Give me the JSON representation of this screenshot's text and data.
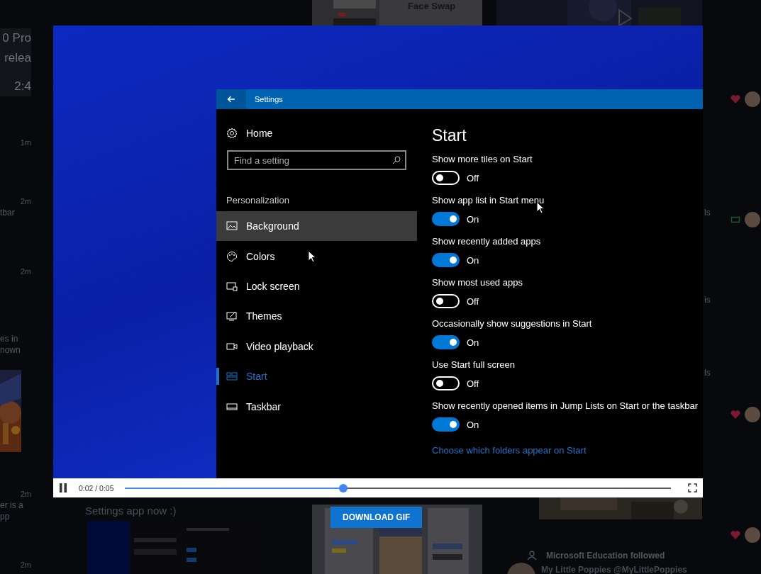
{
  "backdrop": {
    "left_column": [
      {
        "kind": "card",
        "lines": [
          "0 Pro",
          "relea",
          "2:4"
        ]
      },
      {
        "kind": "time",
        "text": "1m"
      },
      {
        "kind": "time",
        "text": "2m"
      },
      {
        "kind": "snippet",
        "text": "tbar"
      },
      {
        "kind": "time",
        "text": "2m"
      },
      {
        "kind": "snippet",
        "text": "es in"
      },
      {
        "kind": "snippet",
        "text": "nown"
      },
      {
        "kind": "picture"
      },
      {
        "kind": "time",
        "text": "2m"
      },
      {
        "kind": "snippet",
        "text": "er is a"
      },
      {
        "kind": "snippet",
        "text": "pp"
      },
      {
        "kind": "time",
        "text": "2m"
      }
    ],
    "post_caption": "Settings app now :)",
    "app_card_title": "Face Swap",
    "download_button": "DOWNLOAD GIF",
    "follow_notice": "Microsoft Education followed",
    "follow_account": "My Little Poppies @MyLittlePoppies",
    "edge_fragments": [
      "ls",
      "is",
      "ls"
    ],
    "reactions": [
      {
        "kind": "heart"
      },
      {
        "kind": "repost"
      },
      {
        "kind": "heart"
      },
      {
        "kind": "heart"
      }
    ]
  },
  "video": {
    "settings_window": {
      "title": "Settings",
      "home": "Home",
      "search": {
        "placeholder": "Find a setting"
      },
      "section": "Personalization",
      "nav": [
        {
          "label": "Background",
          "selected": false,
          "hovered": true
        },
        {
          "label": "Colors",
          "selected": false,
          "hovered": false
        },
        {
          "label": "Lock screen",
          "selected": false,
          "hovered": false
        },
        {
          "label": "Themes",
          "selected": false,
          "hovered": false
        },
        {
          "label": "Video playback",
          "selected": false,
          "hovered": false
        },
        {
          "label": "Start",
          "selected": true,
          "hovered": false
        },
        {
          "label": "Taskbar",
          "selected": false,
          "hovered": false
        }
      ],
      "page_title": "Start",
      "toggles": [
        {
          "label": "Show more tiles on Start",
          "on": false,
          "state_text": "Off"
        },
        {
          "label": "Show app list in Start menu",
          "on": true,
          "state_text": "On"
        },
        {
          "label": "Show recently added apps",
          "on": true,
          "state_text": "On"
        },
        {
          "label": "Show most used apps",
          "on": false,
          "state_text": "Off"
        },
        {
          "label": "Occasionally show suggestions in Start",
          "on": true,
          "state_text": "On"
        },
        {
          "label": "Use Start full screen",
          "on": false,
          "state_text": "Off"
        },
        {
          "label": "Show recently opened items in Jump Lists on Start or the taskbar",
          "on": true,
          "state_text": "On"
        }
      ],
      "link": "Choose which folders appear on Start"
    },
    "player": {
      "playing": true,
      "time": "0:02 / 0:05",
      "level": 0.4
    }
  }
}
